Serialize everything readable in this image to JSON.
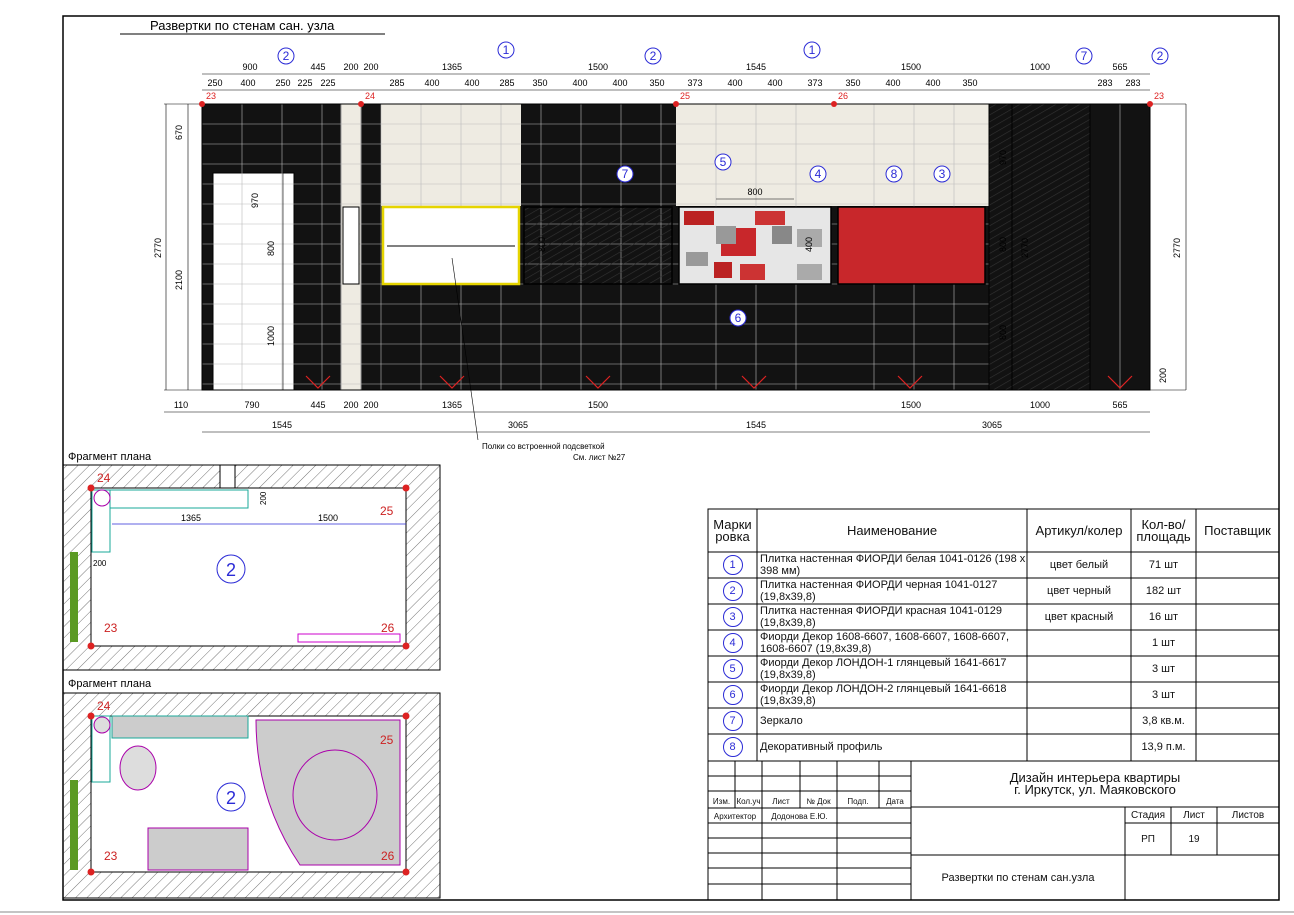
{
  "sheet_title": "Развертки по стенам сан. узла",
  "marker_labels": [
    "1",
    "2",
    "3",
    "4",
    "5",
    "6",
    "7",
    "8"
  ],
  "corner_labels": [
    "23",
    "24",
    "25",
    "26"
  ],
  "top_dims_major": [
    "900",
    "445",
    "200",
    "200",
    "1365",
    "1500",
    "1545",
    "1500",
    "1000",
    "565"
  ],
  "top_dims_minor": [
    "250",
    "400",
    "250",
    "225",
    "225",
    "285",
    "400",
    "400",
    "285",
    "350",
    "400",
    "400",
    "350",
    "373",
    "400",
    "400",
    "373",
    "350",
    "400",
    "400",
    "350",
    "283",
    "283"
  ],
  "bottom_dims_1": [
    "110",
    "790",
    "445",
    "200",
    "200",
    "1365",
    "1500",
    "1500",
    "1000",
    "565"
  ],
  "bottom_dims_2": [
    "1545",
    "3065",
    "1545",
    "3065"
  ],
  "vertical_dims": [
    "670",
    "2770",
    "2100",
    "970",
    "800",
    "1000",
    "2770",
    "970",
    "2770",
    "800",
    "800",
    "200",
    "800",
    "400"
  ],
  "mirror_width": "800",
  "shelf_note_1": "Полки со встроенной подсветкой",
  "shelf_note_2": "См. лист №27",
  "plan_title_1": "Фрагмент плана",
  "plan_title_2": "Фрагмент плана",
  "plan_dims": [
    "1365",
    "1500",
    "200",
    "200"
  ],
  "room_number": "2",
  "spec": {
    "headers": {
      "mark": "Марки ровка",
      "name": "Наименование",
      "article": "Артикул/колер",
      "qty": "Кол-во/ площадь",
      "supplier": "Поставщик"
    },
    "rows": [
      {
        "mark": "1",
        "name": "Плитка настенная ФИОРДИ белая 1041-0126 (198 х 398 мм)",
        "article": "цвет белый",
        "qty": "71 шт"
      },
      {
        "mark": "2",
        "name": "Плитка настенная ФИОРДИ черная 1041-0127 (19,8х39,8)",
        "article": "цвет черный",
        "qty": "182 шт"
      },
      {
        "mark": "3",
        "name": "Плитка настенная ФИОРДИ красная 1041-0129 (19,8х39,8)",
        "article": "цвет красный",
        "qty": "16 шт"
      },
      {
        "mark": "4",
        "name": "Фиорди Декор 1608-6607, 1608-6607, 1608-6607, 1608-6607 (19,8х39,8)",
        "article": "",
        "qty": "1 шт"
      },
      {
        "mark": "5",
        "name": "Фиорди Декор ЛОНДОН-1 глянцевый 1641-6617 (19,8х39,8)",
        "article": "",
        "qty": "3 шт"
      },
      {
        "mark": "6",
        "name": "Фиорди Декор ЛОНДОН-2 глянцевый 1641-6618 (19,8х39,8)",
        "article": "",
        "qty": "3 шт"
      },
      {
        "mark": "7",
        "name": "Зеркало",
        "article": "",
        "qty": "3,8 кв.м."
      },
      {
        "mark": "8",
        "name": "Декоративный профиль",
        "article": "",
        "qty": "13,9 п.м."
      }
    ]
  },
  "title_block": {
    "project_line1": "Дизайн интерьера квартиры",
    "project_line2": "г. Иркутск, ул. Маяковского",
    "cols": [
      "Изм.",
      "Кол.уч",
      "Лист",
      "№ Док",
      "Подп.",
      "Дата"
    ],
    "architect_label": "Архитектор",
    "architect_name": "Додонова Е.Ю.",
    "stage_label": "Стадия",
    "sheet_label": "Лист",
    "sheets_label": "Листов",
    "stage": "РП",
    "sheet": "19",
    "sheets": "",
    "drawing_name": "Развертки по стенам сан.узла"
  },
  "colors": {
    "tile_black": "#121212",
    "tile_white": "#eeebe2",
    "tile_red": "#c8272b",
    "accent_blue": "#2b2bd6",
    "dim_red": "#d22"
  }
}
